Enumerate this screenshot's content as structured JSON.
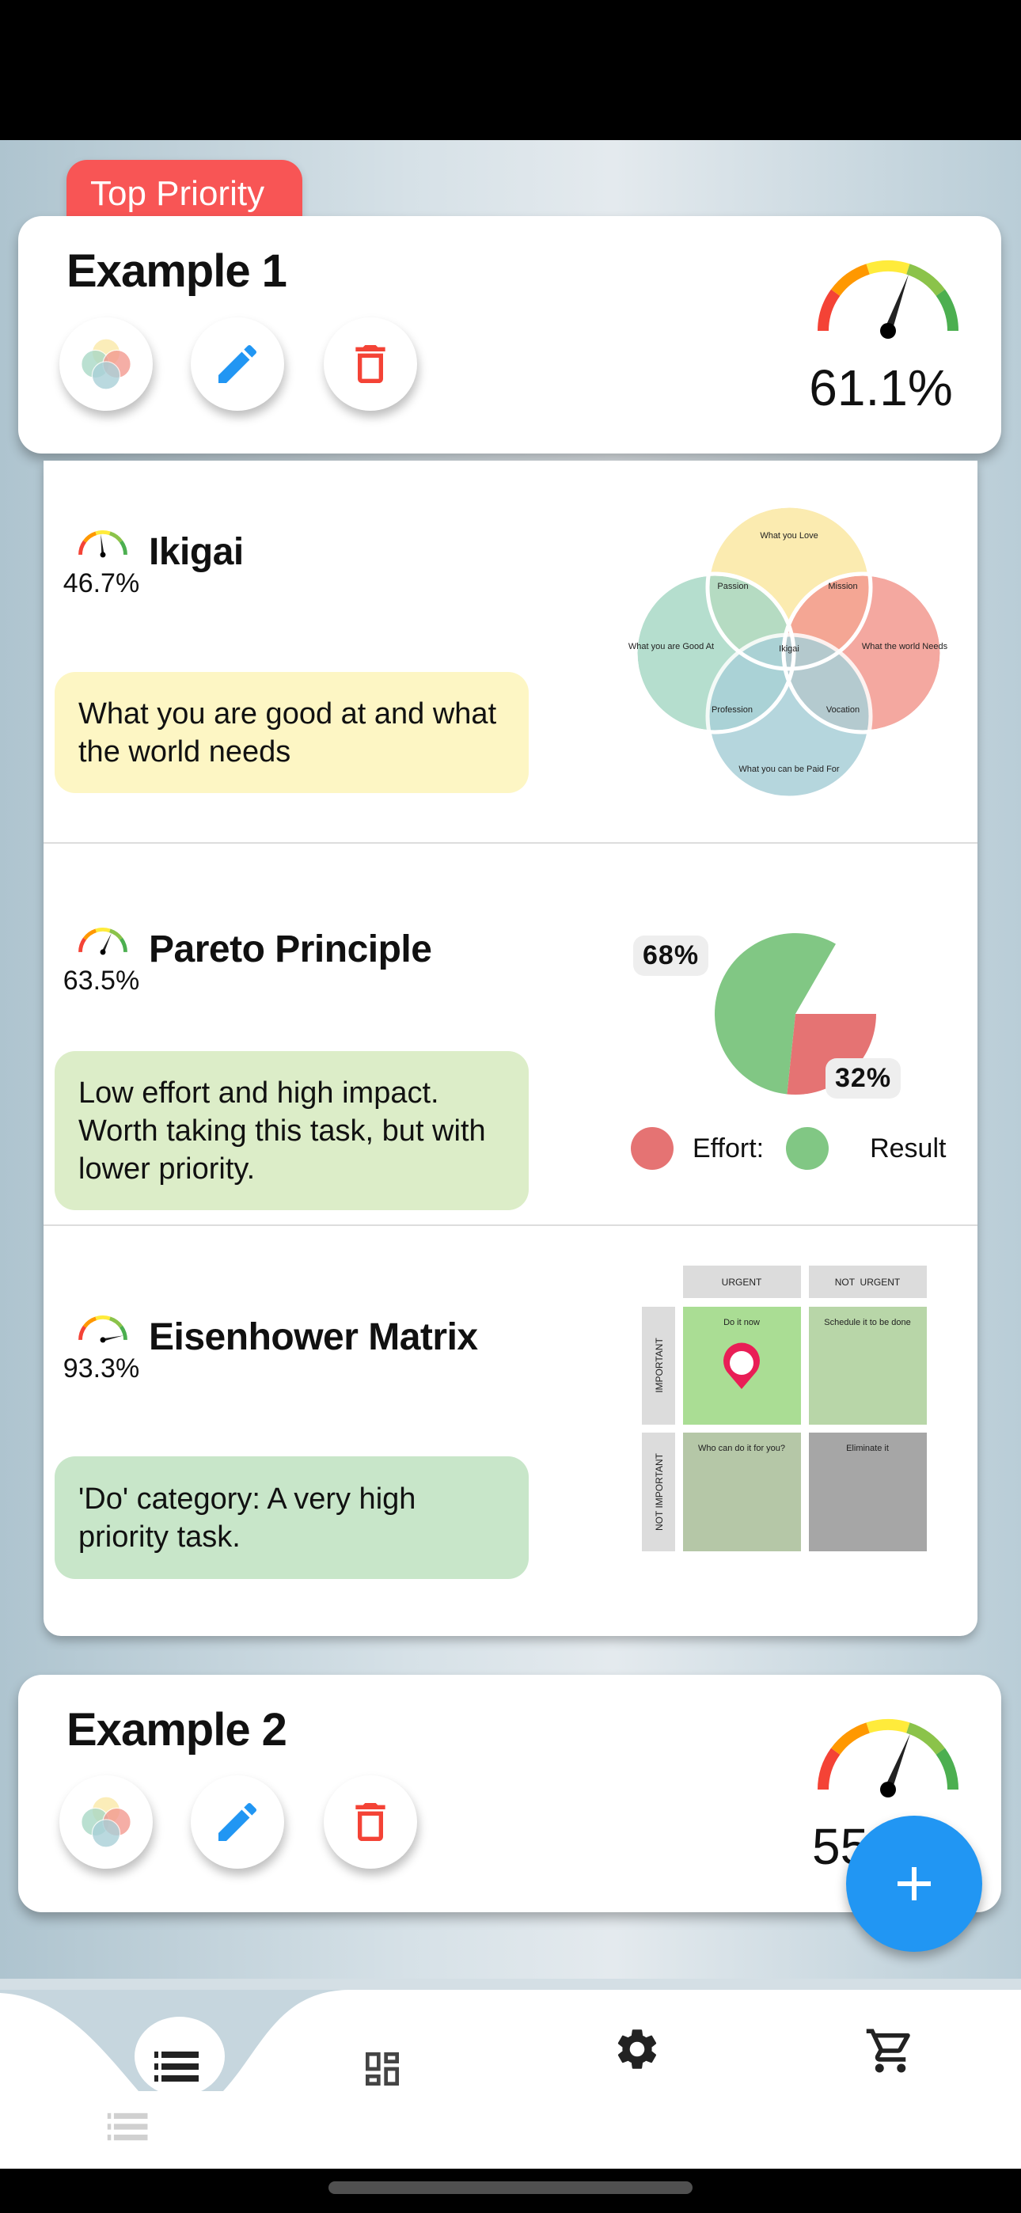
{
  "tasks": [
    {
      "badge": "Top Priority",
      "title": "Example 1",
      "score": 61.1,
      "score_label": "61.1%",
      "buttons": {
        "methods": "venn-icon",
        "edit": "pencil-icon",
        "delete": "trash-icon"
      },
      "methods": [
        {
          "title": "Ikigai",
          "score": 46.7,
          "score_label": "46.7%",
          "note": "What you are good at and what the world needs",
          "note_color": "#fdf6c4",
          "diagram": {
            "circles": [
              "What you Love",
              "What you are Good At",
              "What the world Needs",
              "What you can be Paid For"
            ],
            "overlaps": [
              "Passion",
              "Mission",
              "Profession",
              "Vocation"
            ],
            "center": "Ikigai"
          }
        },
        {
          "title": "Pareto Principle",
          "score": 63.5,
          "score_label": "63.5%",
          "note": "Low effort and high impact. Worth taking this task, but with lower priority.",
          "note_color": "#dcedc8"
        },
        {
          "title": "Eisenhower Matrix",
          "score": 93.3,
          "score_label": "93.3%",
          "note": "'Do' category: A very high priority task.",
          "note_color": "#c8e6c9",
          "matrix": {
            "columns": [
              "URGENT",
              "NOT  URGENT"
            ],
            "rows": [
              "IMPORTANT",
              "NOT IMPORTANT"
            ],
            "cells": [
              "Do it now",
              "Schedule it to be done",
              "Who can do it for you?",
              "Eliminate it"
            ],
            "selected": "Do it now"
          }
        }
      ]
    },
    {
      "title": "Example 2",
      "score_label": "55"
    }
  ],
  "chart_data": {
    "type": "pie",
    "series": [
      {
        "name": "Effort:",
        "value": 32,
        "label": "32%",
        "color": "#e57373"
      },
      {
        "name": "Result",
        "value": 68,
        "label": "68%",
        "color": "#81c784"
      }
    ],
    "legend": "bottom"
  },
  "fab": {
    "icon": "plus-icon",
    "color": "#2196f3"
  },
  "nav": {
    "items": [
      "list-icon",
      "dashboard-icon",
      "settings-gear-icon",
      "cart-icon"
    ],
    "active": "list-icon"
  },
  "colors": {
    "badge": "#f85555",
    "edit": "#2196f3",
    "delete": "#f44336"
  }
}
